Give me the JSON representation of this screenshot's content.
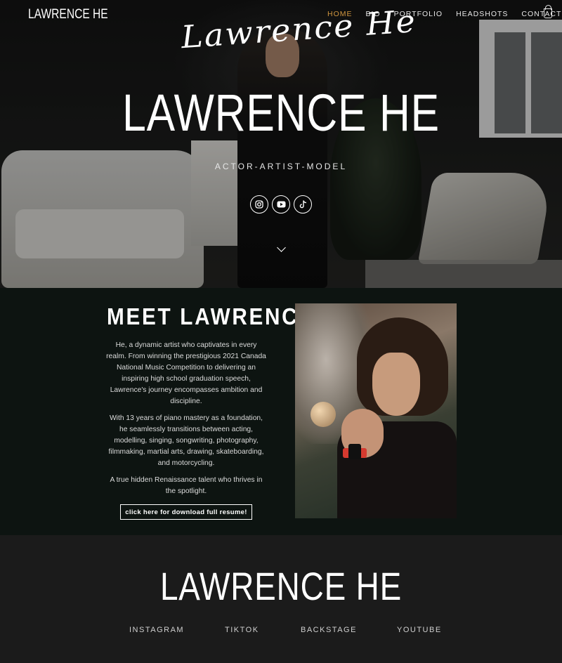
{
  "header": {
    "logo": "LAWRENCE HE",
    "nav": [
      "HOME",
      "BIO",
      "PORTFOLIO",
      "HEADSHOTS",
      "CONTACT"
    ],
    "active_nav": "HOME",
    "accent_color": "#d1963f",
    "cart_icon": "shopping-bag-icon"
  },
  "hero": {
    "signature": "Lawrence He",
    "title": "LAWRENCE HE",
    "subtitle": "ACTOR-ARTIST-MODEL",
    "social_icons": [
      "instagram-icon",
      "youtube-icon",
      "tiktok-icon"
    ],
    "scroll_icon": "chevron-down-icon"
  },
  "meet": {
    "title": "MEET LAWRENCE",
    "paragraphs": [
      "He, a dynamic artist who captivates in every realm. From winning the prestigious 2021 Canada National Music Competition to delivering an inspiring high school graduation speech, Lawrence's journey encompasses ambition and discipline.",
      "With 13 years of piano mastery as a foundation, he seamlessly transitions between acting, modelling, singing, songwriting, photography, filmmaking, martial arts, drawing, skateboarding, and motorcycling.",
      "A true hidden Renaissance talent who thrives in the spotlight."
    ],
    "button": "click here for download full resume!"
  },
  "footer": {
    "title": "LAWRENCE HE",
    "links": [
      "INSTAGRAM",
      "TIKTOK",
      "BACKSTAGE",
      "YOUTUBE"
    ]
  }
}
